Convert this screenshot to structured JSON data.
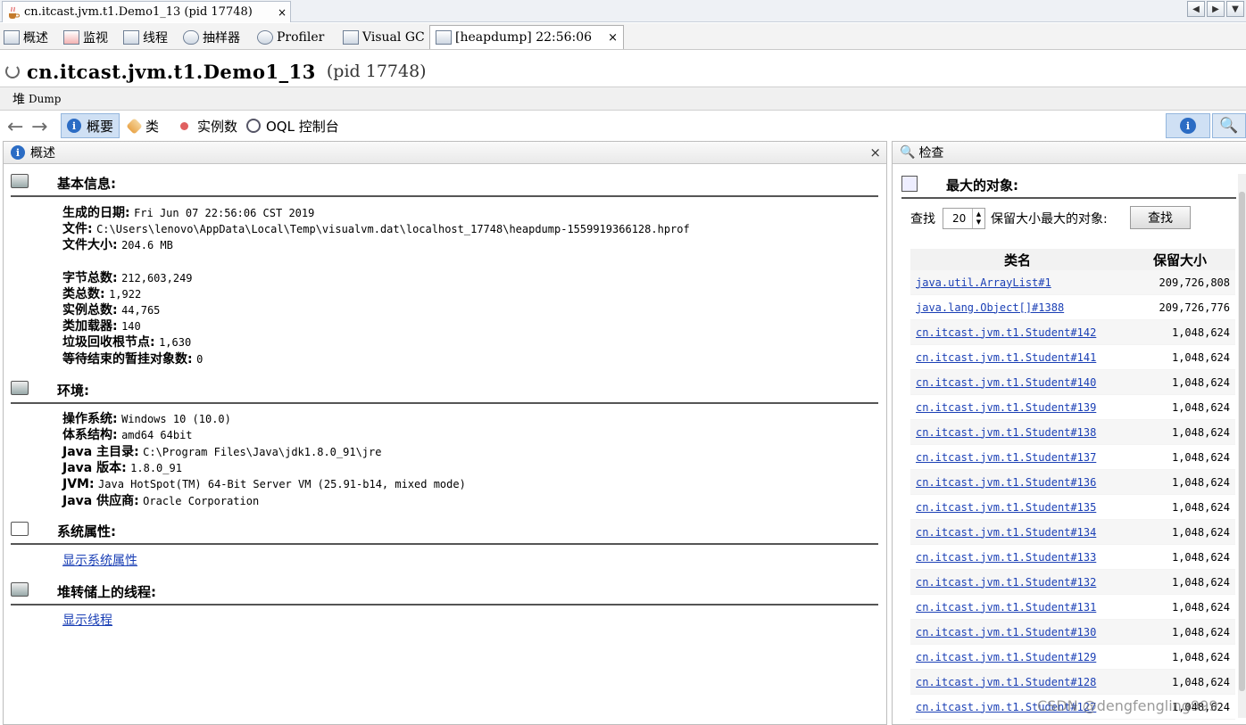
{
  "doc_tab": {
    "title": "cn.itcast.jvm.t1.Demo1_13 (pid 17748)",
    "close": "×"
  },
  "scroll_buttons": [
    "◀",
    "▶",
    "▼"
  ],
  "view_tabs": [
    {
      "label": "概述"
    },
    {
      "label": "监视"
    },
    {
      "label": "线程"
    },
    {
      "label": "抽样器"
    },
    {
      "label": "Profiler"
    },
    {
      "label": "Visual GC"
    },
    {
      "label": "[heapdump] 22:56:06",
      "close": "×"
    }
  ],
  "app_title": {
    "name": "cn.itcast.jvm.t1.Demo1_13",
    "pid": "(pid 17748)"
  },
  "heap_label": {
    "prefix": "堆",
    "suffix": "Dump"
  },
  "toolbar": {
    "back": "←",
    "forward": "→",
    "summary": "概要",
    "classes": "类",
    "instances": "实例数",
    "oql": "OQL 控制台",
    "info_icon": "i",
    "search_icon": "🔍"
  },
  "left_pane": {
    "title": "概述",
    "close": "×",
    "basic": {
      "title": "基本信息:",
      "date_label": "生成的日期:",
      "date_value": "Fri Jun 07 22:56:06 CST 2019",
      "file_label": "文件:",
      "file_value": "C:\\Users\\lenovo\\AppData\\Local\\Temp\\visualvm.dat\\localhost_17748\\heapdump-1559919366128.hprof",
      "size_label": "文件大小:",
      "size_value": "204.6 MB",
      "bytes_label": "字节总数:",
      "bytes_value": "212,603,249",
      "classes_label": "类总数:",
      "classes_value": "1,922",
      "instances_label": "实例总数:",
      "instances_value": "44,765",
      "loaders_label": "类加载器:",
      "loaders_value": "140",
      "gcroots_label": "垃圾回收根节点:",
      "gcroots_value": "1,630",
      "pending_label": "等待结束的暂挂对象数:",
      "pending_value": "0"
    },
    "env": {
      "title": "环境:",
      "os_label": "操作系统:",
      "os_value": "Windows 10 (10.0)",
      "arch_label": "体系结构:",
      "arch_value": "amd64 64bit",
      "home_label": "Java 主目录:",
      "home_value": "C:\\Program Files\\Java\\jdk1.8.0_91\\jre",
      "ver_label": "Java 版本:",
      "ver_value": "1.8.0_91",
      "jvm_label": "JVM:",
      "jvm_value": "Java HotSpot(TM) 64-Bit Server VM (25.91-b14, mixed mode)",
      "vendor_label": "Java 供应商:",
      "vendor_value": "Oracle Corporation"
    },
    "sysprops": {
      "title": "系统属性:",
      "link": "显示系统属性"
    },
    "threads": {
      "title": "堆转储上的线程:",
      "link": "显示线程"
    }
  },
  "right_pane": {
    "title": "检查",
    "largest_title": "最大的对象:",
    "find_label": "查找",
    "count": "20",
    "retained_label": "保留大小最大的对象:",
    "find_button": "查找",
    "col_class": "类名",
    "col_size": "保留大小",
    "rows": [
      {
        "name": "java.util.ArrayList#1",
        "size": "209,726,808"
      },
      {
        "name": "java.lang.Object[]#1388",
        "size": "209,726,776"
      },
      {
        "name": "cn.itcast.jvm.t1.Student#142",
        "size": "1,048,624"
      },
      {
        "name": "cn.itcast.jvm.t1.Student#141",
        "size": "1,048,624"
      },
      {
        "name": "cn.itcast.jvm.t1.Student#140",
        "size": "1,048,624"
      },
      {
        "name": "cn.itcast.jvm.t1.Student#139",
        "size": "1,048,624"
      },
      {
        "name": "cn.itcast.jvm.t1.Student#138",
        "size": "1,048,624"
      },
      {
        "name": "cn.itcast.jvm.t1.Student#137",
        "size": "1,048,624"
      },
      {
        "name": "cn.itcast.jvm.t1.Student#136",
        "size": "1,048,624"
      },
      {
        "name": "cn.itcast.jvm.t1.Student#135",
        "size": "1,048,624"
      },
      {
        "name": "cn.itcast.jvm.t1.Student#134",
        "size": "1,048,624"
      },
      {
        "name": "cn.itcast.jvm.t1.Student#133",
        "size": "1,048,624"
      },
      {
        "name": "cn.itcast.jvm.t1.Student#132",
        "size": "1,048,624"
      },
      {
        "name": "cn.itcast.jvm.t1.Student#131",
        "size": "1,048,624"
      },
      {
        "name": "cn.itcast.jvm.t1.Student#130",
        "size": "1,048,624"
      },
      {
        "name": "cn.itcast.jvm.t1.Student#129",
        "size": "1,048,624"
      },
      {
        "name": "cn.itcast.jvm.t1.Student#128",
        "size": "1,048,624"
      },
      {
        "name": "cn.itcast.jvm.t1.Student#127",
        "size": "1,048,624"
      }
    ]
  },
  "watermark": "CSDN @dengfengling999"
}
